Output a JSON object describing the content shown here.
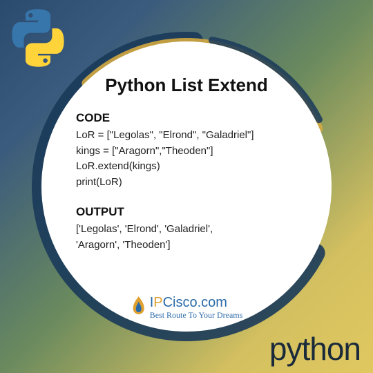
{
  "title": "Python List Extend",
  "code_heading": "CODE",
  "code_lines": [
    "LoR = [\"Legolas\", \"Elrond\", \"Galadriel\"]",
    "kings = [\"Aragorn\",\"Theoden\"]",
    "LoR.extend(kings)",
    "print(LoR)"
  ],
  "output_heading": "OUTPUT",
  "output_lines": [
    "['Legolas', 'Elrond', 'Galadriel',",
    "'Aragorn', 'Theoden']"
  ],
  "brand": {
    "name_i": "I",
    "name_p": "P",
    "name_rest": "Cisco.com",
    "tagline": "Best Route To Your Dreams"
  },
  "footer_word": "python",
  "colors": {
    "py_blue": "#3776ab",
    "py_yellow": "#ffd43b",
    "brush_dark": "#1a3a5a",
    "brush_gold": "#d4a840"
  }
}
